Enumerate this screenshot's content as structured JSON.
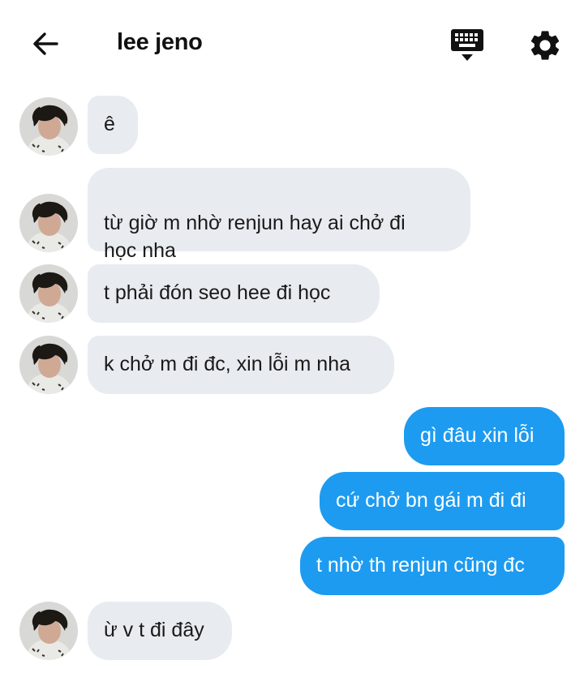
{
  "header": {
    "title": "lee jeno",
    "icons": {
      "back": "arrow-left-icon",
      "keyboard": "keyboard-icon",
      "settings": "gear-icon"
    }
  },
  "messages": [
    {
      "from": "them",
      "text": "ê"
    },
    {
      "from": "them",
      "text": "từ giờ m nhờ renjun hay ai chở đi\nhọc nha"
    },
    {
      "from": "them",
      "text": "t phải đón seo hee đi học"
    },
    {
      "from": "them",
      "text": "k chở m đi đc, xin lỗi m nha"
    },
    {
      "from": "me",
      "text": "gì đâu xin lỗi"
    },
    {
      "from": "me",
      "text": "cứ chở bn gái m đi đi"
    },
    {
      "from": "me",
      "text": "t nhờ th renjun cũng đc"
    },
    {
      "from": "them",
      "text": "ừ v t đi đây"
    }
  ],
  "colors": {
    "incoming_bubble": "#e8ebf0",
    "outgoing_bubble": "#1d9bf0",
    "background": "#ffffff"
  }
}
